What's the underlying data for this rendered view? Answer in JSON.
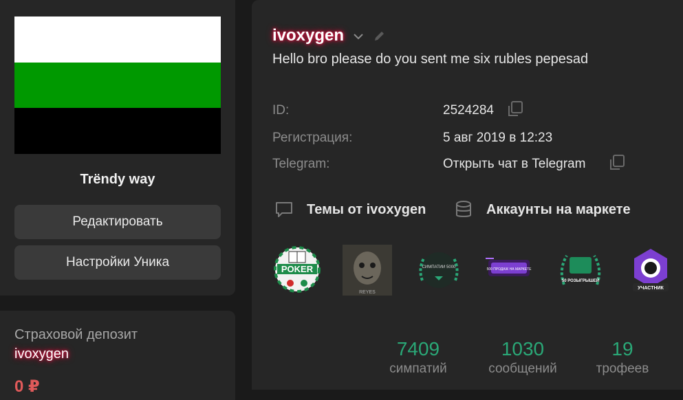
{
  "sidebar": {
    "flag_colors": [
      "#ffffff",
      "#009900",
      "#000000"
    ],
    "uniq_name": "Trëndy way",
    "edit_button": "Редактировать",
    "settings_button": "Настройки Уника",
    "deposit_title": "Страховой депозит",
    "deposit_user": "ivoxygen",
    "deposit_amount": "0 ₽"
  },
  "profile": {
    "username": "ivoxygen",
    "status": "Hello bro please do you sent me six rubles pepesad",
    "info": [
      {
        "label": "ID:",
        "value": "2524284"
      },
      {
        "label": "Регистрация:",
        "value": "5 авг 2019 в 12:23"
      },
      {
        "label": "Telegram:",
        "value": "Открыть чат в Telegram"
      }
    ],
    "links": {
      "topics": "Темы от ivoxygen",
      "market": "Аккаунты на маркете"
    },
    "trophies": [
      {
        "name": "poker",
        "text": "POKER"
      },
      {
        "name": "reyes-portrait",
        "text": "REYES"
      },
      {
        "name": "likes-5000",
        "text": "СИМПАТИИ 5000"
      },
      {
        "name": "sales-500",
        "text": "500 ПРОДАЖ НА МАРКЕТЕ"
      },
      {
        "name": "giveaways-50",
        "text": "50 РОЗЫГРЫШЕЙ"
      },
      {
        "name": "participant",
        "text": "УЧАСТНИК"
      }
    ],
    "stats": [
      {
        "value": "7409",
        "label": "симпатий"
      },
      {
        "value": "1030",
        "label": "сообщений"
      },
      {
        "value": "19",
        "label": "трофеев"
      }
    ]
  },
  "colors": {
    "accent_green": "#2aa877",
    "glow": "#c0143c",
    "card_bg": "#262626",
    "page_bg": "#1a1a1a"
  }
}
